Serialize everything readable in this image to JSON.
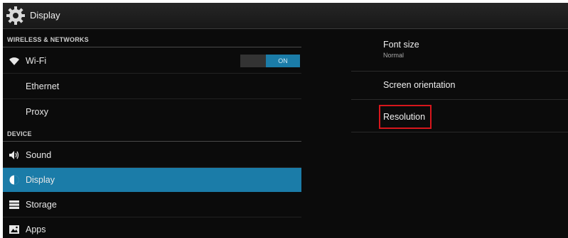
{
  "action_bar": {
    "title": "Display",
    "icon": "gear-icon"
  },
  "sidebar": {
    "sections": [
      {
        "header": "WIRELESS & NETWORKS",
        "items": [
          {
            "label": "Wi-Fi",
            "icon": "wifi-icon",
            "toggle": "ON"
          },
          {
            "label": "Ethernet"
          },
          {
            "label": "Proxy"
          }
        ]
      },
      {
        "header": "DEVICE",
        "items": [
          {
            "label": "Sound",
            "icon": "speaker-icon"
          },
          {
            "label": "Display",
            "icon": "brightness-icon",
            "selected": true
          },
          {
            "label": "Storage",
            "icon": "storage-icon"
          },
          {
            "label": "Apps",
            "icon": "apps-icon"
          }
        ]
      }
    ]
  },
  "display_settings": {
    "items": [
      {
        "title": "Font size",
        "summary": "Normal"
      },
      {
        "title": "Screen orientation"
      },
      {
        "title": "Resolution",
        "highlighted": true
      }
    ]
  },
  "colors": {
    "background": "#0b0b0b",
    "accent": "#1b7ca8",
    "highlight": "#d8161c"
  }
}
